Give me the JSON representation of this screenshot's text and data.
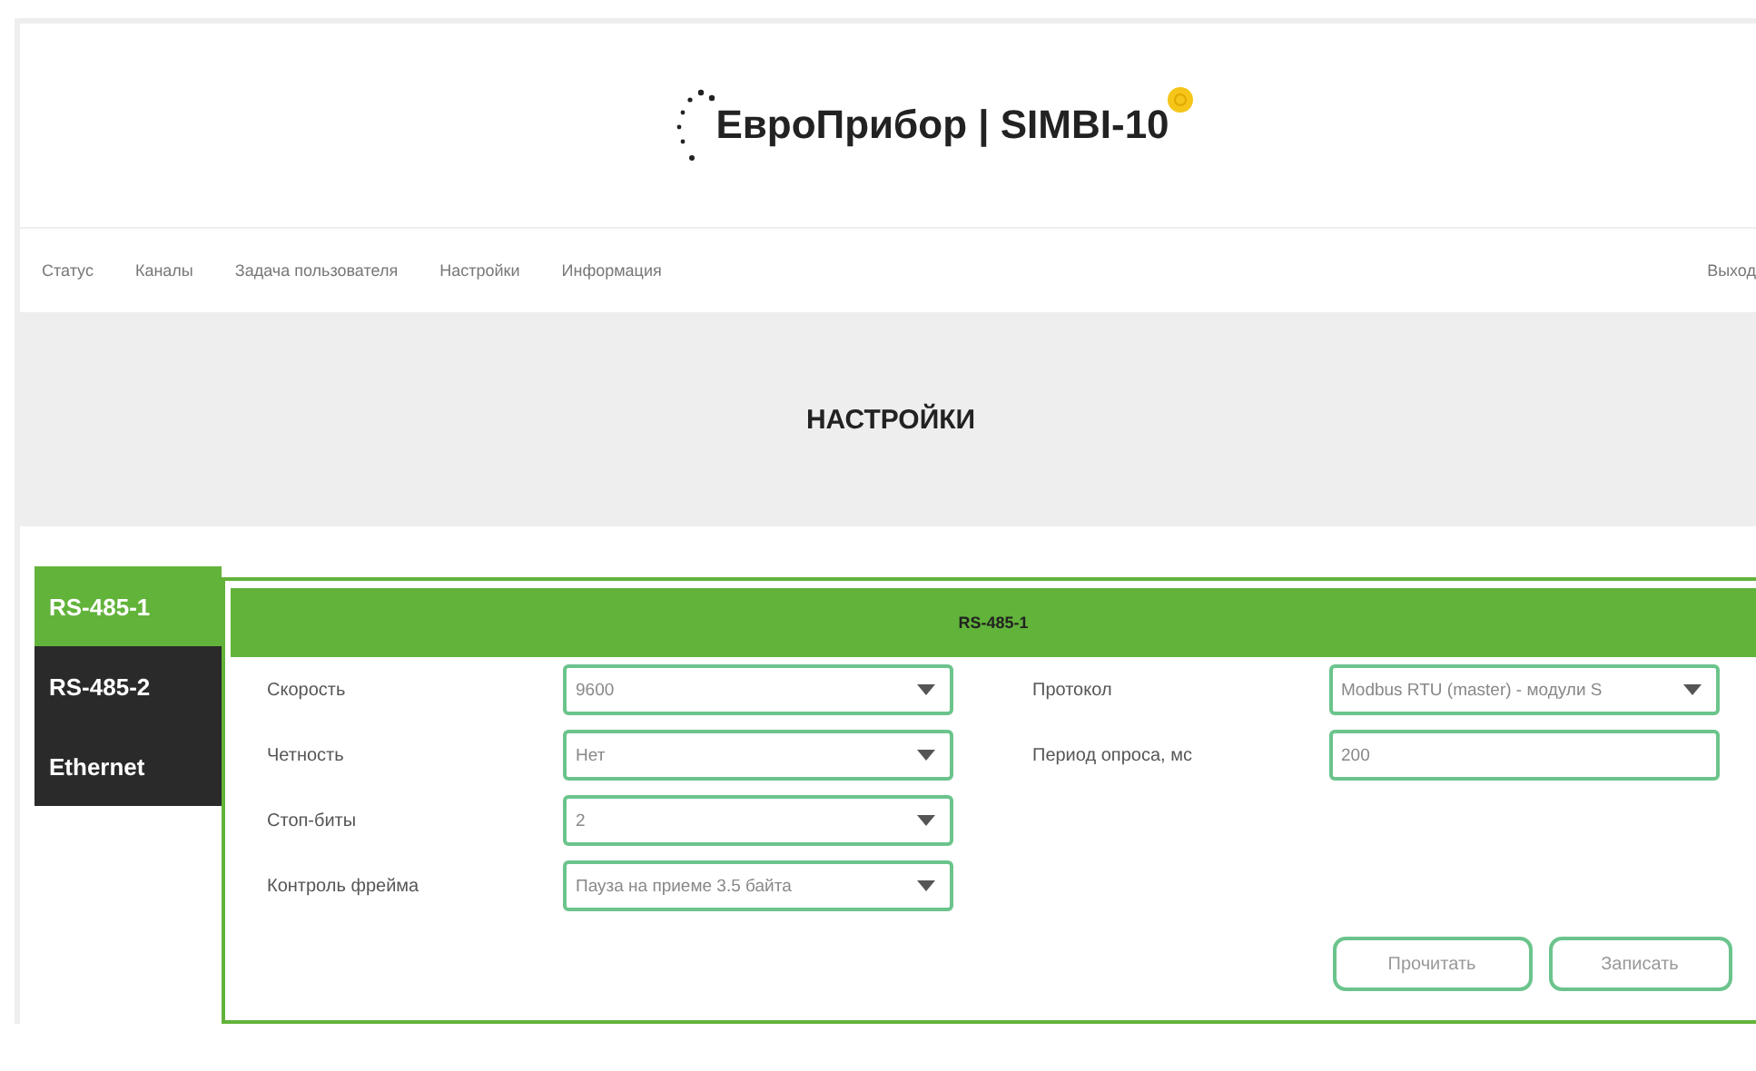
{
  "logo": {
    "text": "ЕвроПрибор | SIMBI-10"
  },
  "nav": [
    {
      "label": "Статус"
    },
    {
      "label": "Каналы"
    },
    {
      "label": "Задача пользователя"
    },
    {
      "label": "Настройки"
    },
    {
      "label": "Информация"
    }
  ],
  "logout": "Выход",
  "page_title": "НАСТРОЙКИ",
  "tabs": [
    {
      "label": "RS-485-1",
      "selected": true
    },
    {
      "label": "RS-485-2",
      "selected": false
    },
    {
      "label": "Ethernet",
      "selected": false
    }
  ],
  "panel": {
    "title": "RS-485-1",
    "left_fields": [
      {
        "label": "Скорость",
        "value": "9600",
        "kind": "select"
      },
      {
        "label": "Четность",
        "value": "Нет",
        "kind": "select"
      },
      {
        "label": "Стоп-биты",
        "value": "2",
        "kind": "select"
      },
      {
        "label": "Контроль фрейма",
        "value": "Пауза на приеме 3.5 байта",
        "kind": "select"
      }
    ],
    "right_fields": [
      {
        "label": "Протокол",
        "value": "Modbus RTU (master) - модули S",
        "kind": "select"
      },
      {
        "label": "Период опроса, мс",
        "value": "200",
        "kind": "input"
      }
    ],
    "buttons": [
      "Прочитать",
      "Записать"
    ]
  }
}
